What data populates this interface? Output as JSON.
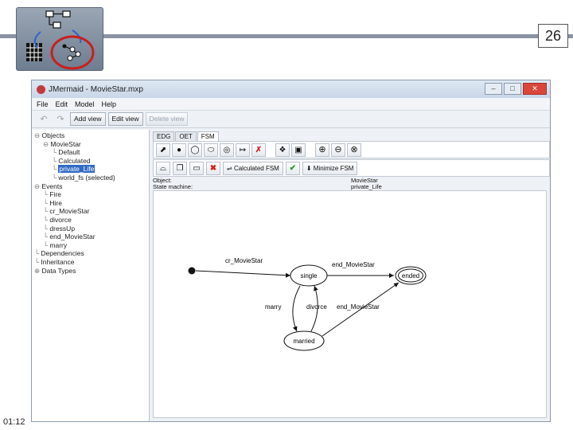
{
  "slide": {
    "page_number": "26",
    "time": "01:12"
  },
  "window": {
    "title": "JMermaid - MovieStar.mxp"
  },
  "menu": [
    "File",
    "Edit",
    "Model",
    "Help"
  ],
  "toolbar": {
    "undo_icon": "undo-icon",
    "redo_icon": "redo-icon",
    "add_view": "Add view",
    "edit_view": "Edit view",
    "delete_view": "Delete view"
  },
  "tree": [
    {
      "label": "Objects",
      "indent": 0,
      "toggle": "-"
    },
    {
      "label": "MovieStar",
      "indent": 1,
      "toggle": "-"
    },
    {
      "label": "Default",
      "indent": 2
    },
    {
      "label": "Calculated",
      "indent": 2
    },
    {
      "label": "private_Life",
      "indent": 2,
      "selected": true
    },
    {
      "label": "world_fs (selected)",
      "indent": 2
    },
    {
      "label": "Events",
      "indent": 0,
      "toggle": "-"
    },
    {
      "label": "Fire",
      "indent": 1
    },
    {
      "label": "Hire",
      "indent": 1
    },
    {
      "label": "cr_MovieStar",
      "indent": 1
    },
    {
      "label": "divorce",
      "indent": 1
    },
    {
      "label": "dressUp",
      "indent": 1
    },
    {
      "label": "end_MovieStar",
      "indent": 1
    },
    {
      "label": "marry",
      "indent": 1
    },
    {
      "label": "Dependencies",
      "indent": 0
    },
    {
      "label": "Inheritance",
      "indent": 0
    },
    {
      "label": "Data Types",
      "indent": 0,
      "toggle": "+"
    }
  ],
  "tabs": [
    "EDG",
    "OET",
    "FSM"
  ],
  "active_tab": "FSM",
  "fsm_toolbar": {
    "calculated_fsm": "Calculated FSM",
    "minimize_fsm": "Minimize FSM"
  },
  "info": {
    "object_label": "Object:",
    "object_value": "MovieStar",
    "machine_label": "State machine:",
    "machine_value": "private_Life"
  },
  "diagram": {
    "states": [
      "single",
      "married",
      "ended"
    ],
    "transitions": [
      "cr_MovieStar",
      "end_MovieStar",
      "marry",
      "divorce",
      "end_MovieStar"
    ]
  }
}
